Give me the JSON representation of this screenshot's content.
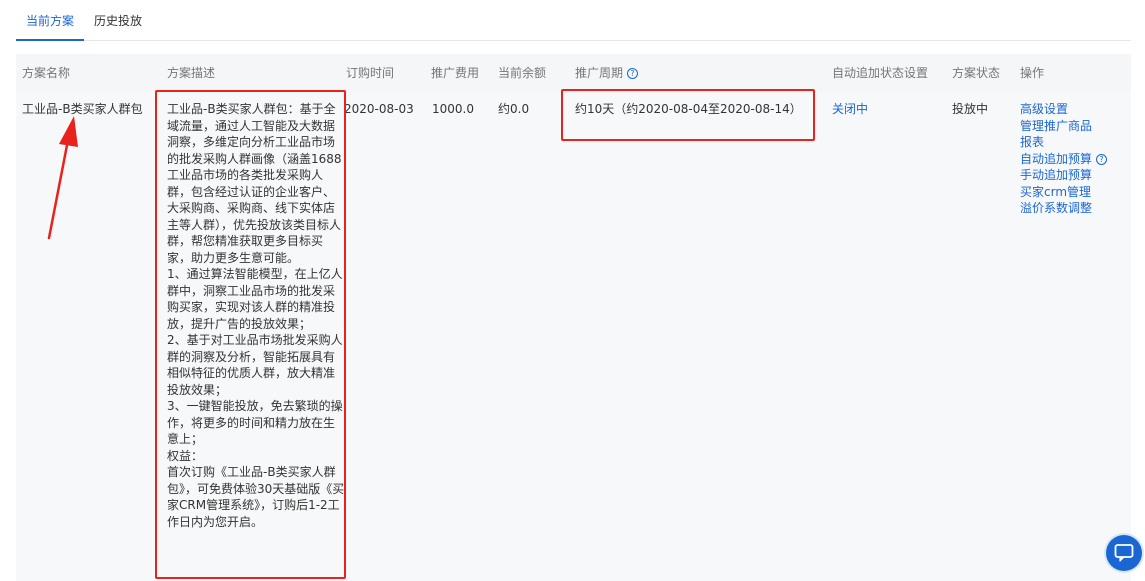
{
  "tabs": [
    {
      "label": "当前方案",
      "active": true
    },
    {
      "label": "历史投放",
      "active": false
    }
  ],
  "columns": {
    "name": "方案名称",
    "desc": "方案描述",
    "order_time": "订购时间",
    "fee": "推广费用",
    "balance": "当前余额",
    "period": "推广周期",
    "auto_setting": "自动追加状态设置",
    "status": "方案状态",
    "ops": "操作"
  },
  "row": {
    "name": "工业品-B类买家人群包",
    "description": "工业品-B类买家人群包：基于全域流量，通过人工智能及大数据洞察，多维定向分析工业品市场的批发采购人群画像（涵盖1688工业品市场的各类批发采购人群，包含经过认证的企业客户、大采购商、采购商、线下实体店主等人群），优先投放该类目标人群，帮您精准获取更多目标买家，助力更多生意可能。\n1、通过算法智能模型，在上亿人群中，洞察工业品市场的批发采购买家，实现对该人群的精准投放，提升广告的投放效果；\n2、基于对工业品市场批发采购人群的洞察及分析，智能拓展具有相似特征的优质人群，放大精准投放效果；\n3、一键智能投放，免去繁琐的操作，将更多的时间和精力放在生意上；\n权益：\n首次订购《工业品-B类买家人群包》，可免费体验30天基础版《买家CRM管理系统》，订购后1-2工作日内为您开启。",
    "order_time": "2020-08-03",
    "fee": "1000.0",
    "balance": "约0.0",
    "period": "约10天（约2020-08-04至2020-08-14）",
    "auto_status": "关闭中",
    "status": "投放中",
    "ops": [
      "高级设置",
      "管理推广商品",
      "报表",
      "自动追加预算",
      "手动追加预算",
      "买家crm管理",
      "溢价系数调整"
    ]
  },
  "icons": {
    "help": "question-circle-icon",
    "chat": "chat-bubble-icon",
    "annotation": "red-arrow-icon"
  },
  "colors": {
    "accent": "#1a66d2",
    "highlight": "#e8231d",
    "header_bg": "#f4f6f8",
    "row_bg": "#f7f8fa"
  }
}
